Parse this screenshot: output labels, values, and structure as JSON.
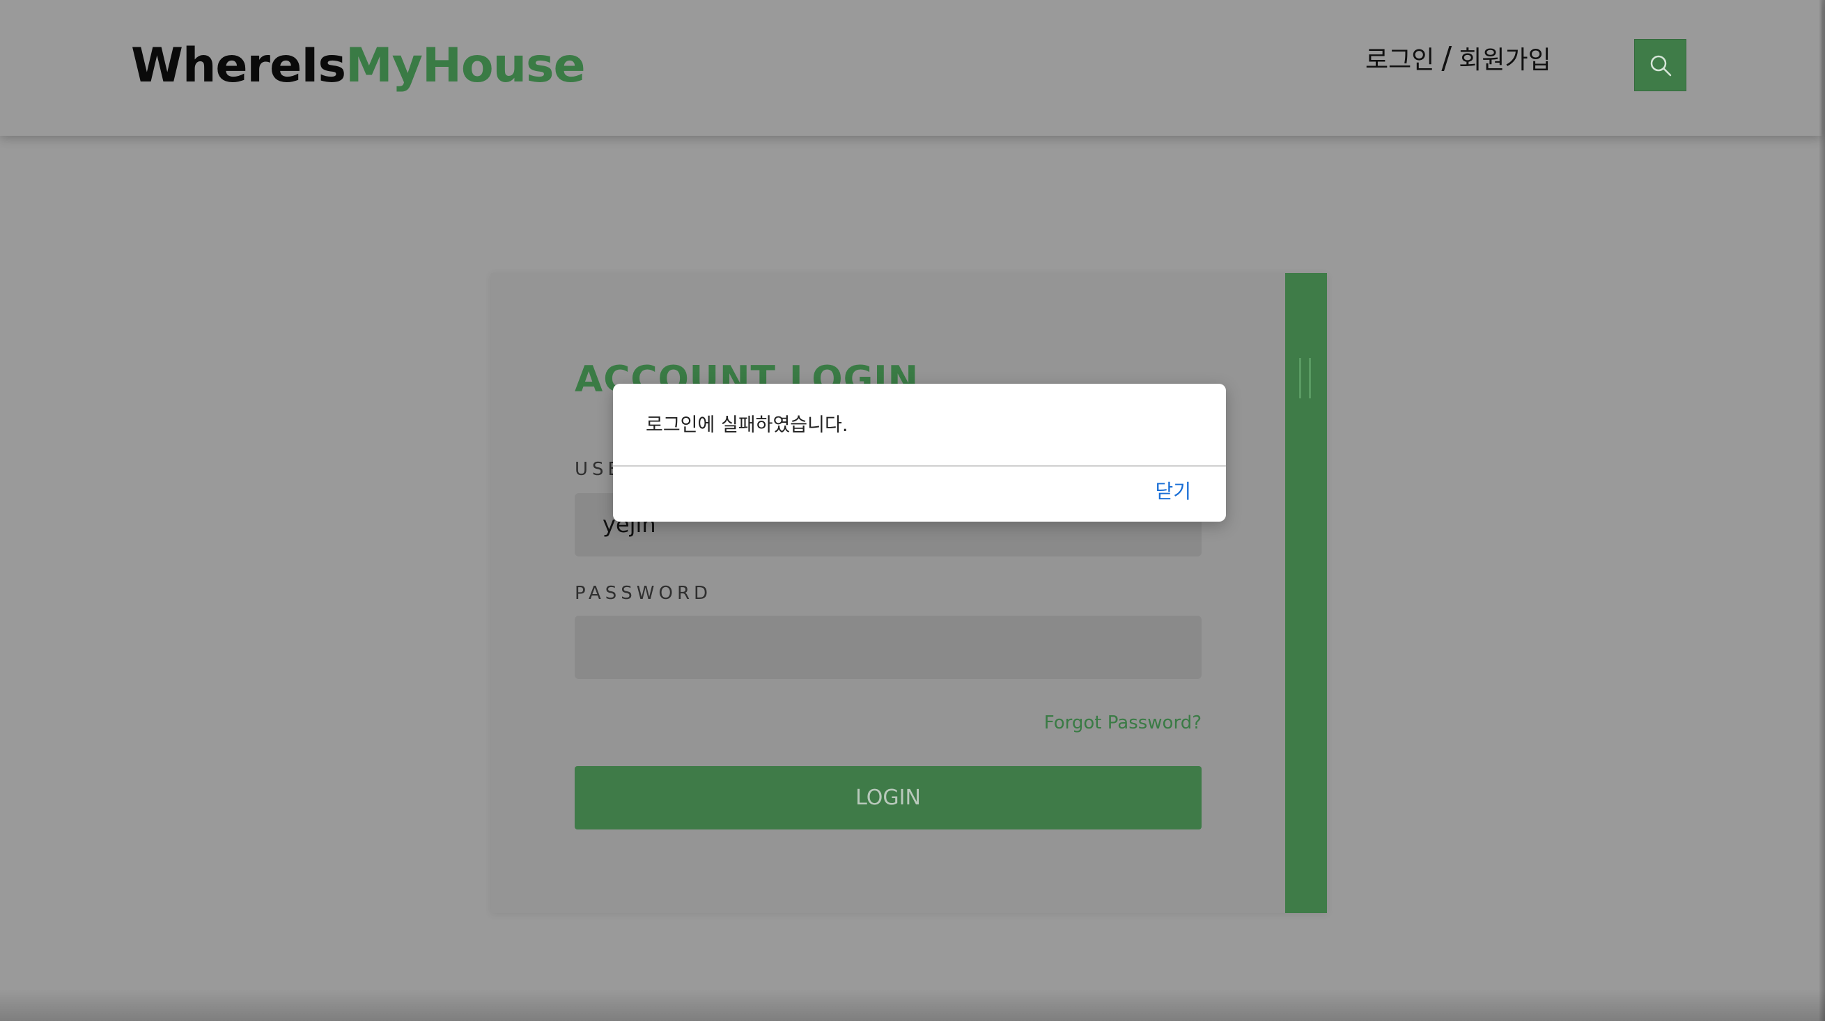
{
  "header": {
    "brand_part1": "WhereIs",
    "brand_part2": "MyHouse",
    "login_link": "로그인",
    "separator": "/",
    "signup_link": "회원가입",
    "search_icon": "search-icon"
  },
  "login_card": {
    "title": "ACCOUNT LOGIN",
    "username_label": "USERNAME",
    "username_value": "yejin",
    "password_label": "PASSWORD",
    "password_value": "",
    "forgot_link": "Forgot Password?",
    "login_button": "LOGIN"
  },
  "dialog": {
    "message": "로그인에 실패하였습니다.",
    "close_button": "닫기"
  },
  "colors": {
    "brand_green": "#3a7b45",
    "overlay_gray": "#9a9a9a",
    "dialog_link_blue": "#1a6fd6"
  }
}
